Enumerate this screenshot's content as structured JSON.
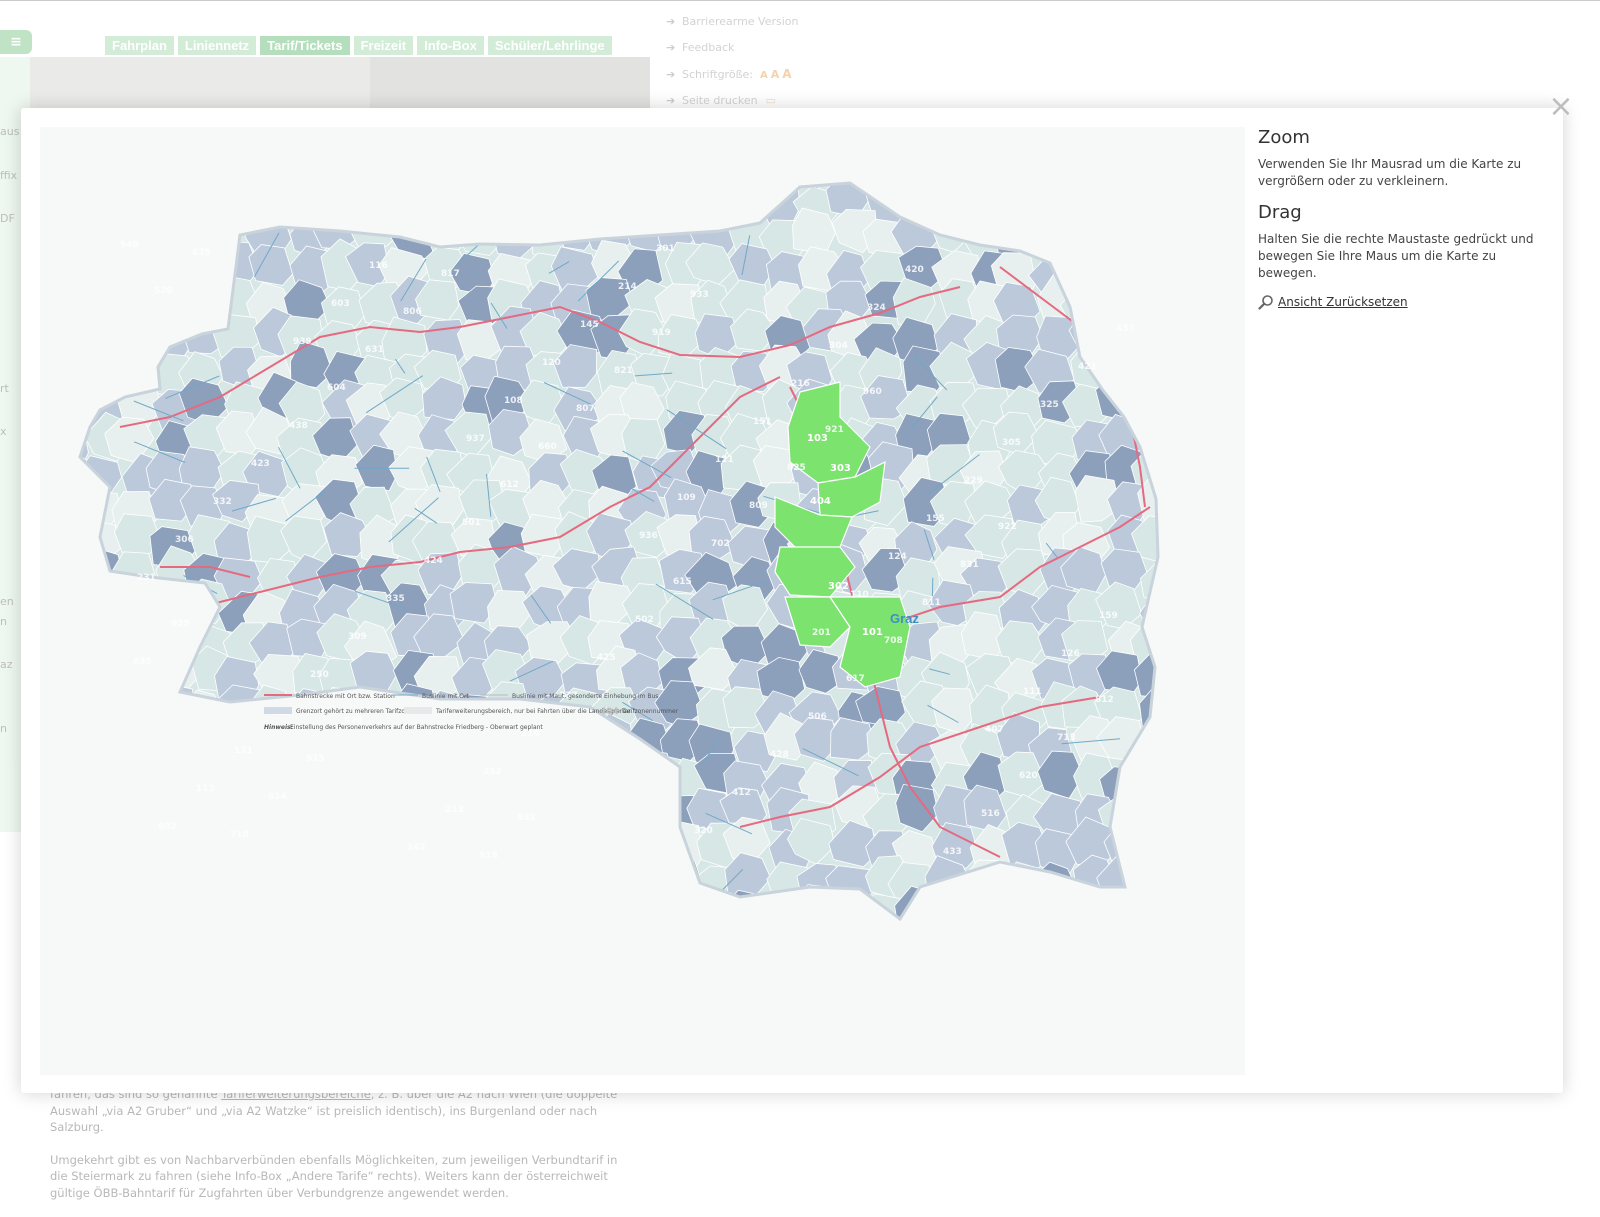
{
  "background_page": {
    "nav_tabs": [
      {
        "label": "Fahrplan",
        "active": false
      },
      {
        "label": "Liniennetz",
        "active": false
      },
      {
        "label": "Tarif/Tickets",
        "active": true
      },
      {
        "label": "Freizeit",
        "active": false
      },
      {
        "label": "Info-Box",
        "active": false
      },
      {
        "label": "Schüler/Lehrlinge",
        "active": false
      }
    ],
    "service_links": {
      "accessible": "Barrierearme Version",
      "feedback": "Feedback",
      "font_size": "Schriftgröße:",
      "print": "Seite drucken"
    },
    "left_strip_fragments": [
      "aus",
      "ffix",
      "DF",
      "rt",
      "x",
      "en",
      "n",
      "az",
      "n"
    ],
    "body_text": {
      "p1_before": "fahren, das sind so genannte ",
      "p1_link": "Tariferweiterungsbereiche",
      "p1_after": ", z. B. über die A2 nach Wien (die doppelte Auswahl „via A2 Gruber“ und „via A2 Watzke“ ist preislich identisch), ins Burgenland oder nach Salzburg.",
      "p2": "Umgekehrt gibt es von Nachbarverbünden ebenfalls Möglichkeiten, zum jeweiligen Verbundtarif in die Steiermark zu fahren (siehe Info-Box „Andere Tarife“ rechts). Weiters kann der österreichweit gültige ÖBB-Bahntarif für Zugfahrten über Verbundgrenze angewendet werden."
    }
  },
  "modal": {
    "help": {
      "zoom_title": "Zoom",
      "zoom_text": "Verwenden Sie Ihr Mausrad um die Karte zu vergrößern oder zu verkleinern.",
      "drag_title": "Drag",
      "drag_text": "Halten Sie die rechte Maustaste gedrückt und bewegen Sie Ihre Maus um die Karte zu bewegen.",
      "reset_label": "Ansicht Zurücksetzen"
    },
    "map": {
      "highlight_label": "Graz",
      "zone_numbers": [
        "940",
        "939",
        "937",
        "936",
        "101",
        "103",
        "303",
        "404",
        "302",
        "201",
        "407",
        "602",
        "603",
        "108",
        "109",
        "110",
        "111",
        "113",
        "116",
        "120",
        "121",
        "124",
        "126",
        "131",
        "142",
        "145",
        "151",
        "155",
        "159",
        "211",
        "213",
        "214",
        "216",
        "229",
        "231",
        "250",
        "252",
        "301",
        "304",
        "305",
        "306",
        "309",
        "314",
        "320",
        "324",
        "325",
        "332",
        "335",
        "337",
        "412",
        "420",
        "421",
        "423",
        "424",
        "425",
        "428",
        "433",
        "437",
        "438",
        "501",
        "502",
        "506",
        "516",
        "520",
        "604",
        "612",
        "615",
        "617",
        "620",
        "625",
        "631",
        "660",
        "702",
        "708",
        "713",
        "718",
        "806",
        "807",
        "809",
        "811",
        "812",
        "814",
        "817",
        "821",
        "825",
        "831",
        "835",
        "915",
        "918",
        "919",
        "921",
        "922",
        "925",
        "928",
        "932",
        "933",
        "960"
      ],
      "highlight_zones": [
        "103",
        "303",
        "404",
        "302",
        "101"
      ],
      "legend": {
        "rail": "Bahnstrecke mit Ort bzw. Station",
        "bus": "Buslinie mit Ort",
        "bus_toll": "Buslinie mit Maut, gesonderte Einhebung im Bus",
        "shared_border": "Grenzort gehört zu mehreren Tarifzonen",
        "extension": "Tariferweiterungsbereich, nur bei Fahrten über die Landesgrenze",
        "zone_number": "Tarifzonennummer",
        "zone_number_example": "404",
        "note_label": "Hinweis:",
        "note_text": "Einstellung des Personenverkehrs auf der Bahnstrecke Friedberg - Oberwart geplant"
      },
      "colors": {
        "zone_dark": "#8c9fbb",
        "zone_mid": "#bcc9db",
        "zone_light": "#d6e7e5",
        "zone_pale": "#e8f0ef",
        "highlight": "#7de36f",
        "rail": "#e56a80",
        "bus": "#6fa9c7"
      }
    }
  }
}
